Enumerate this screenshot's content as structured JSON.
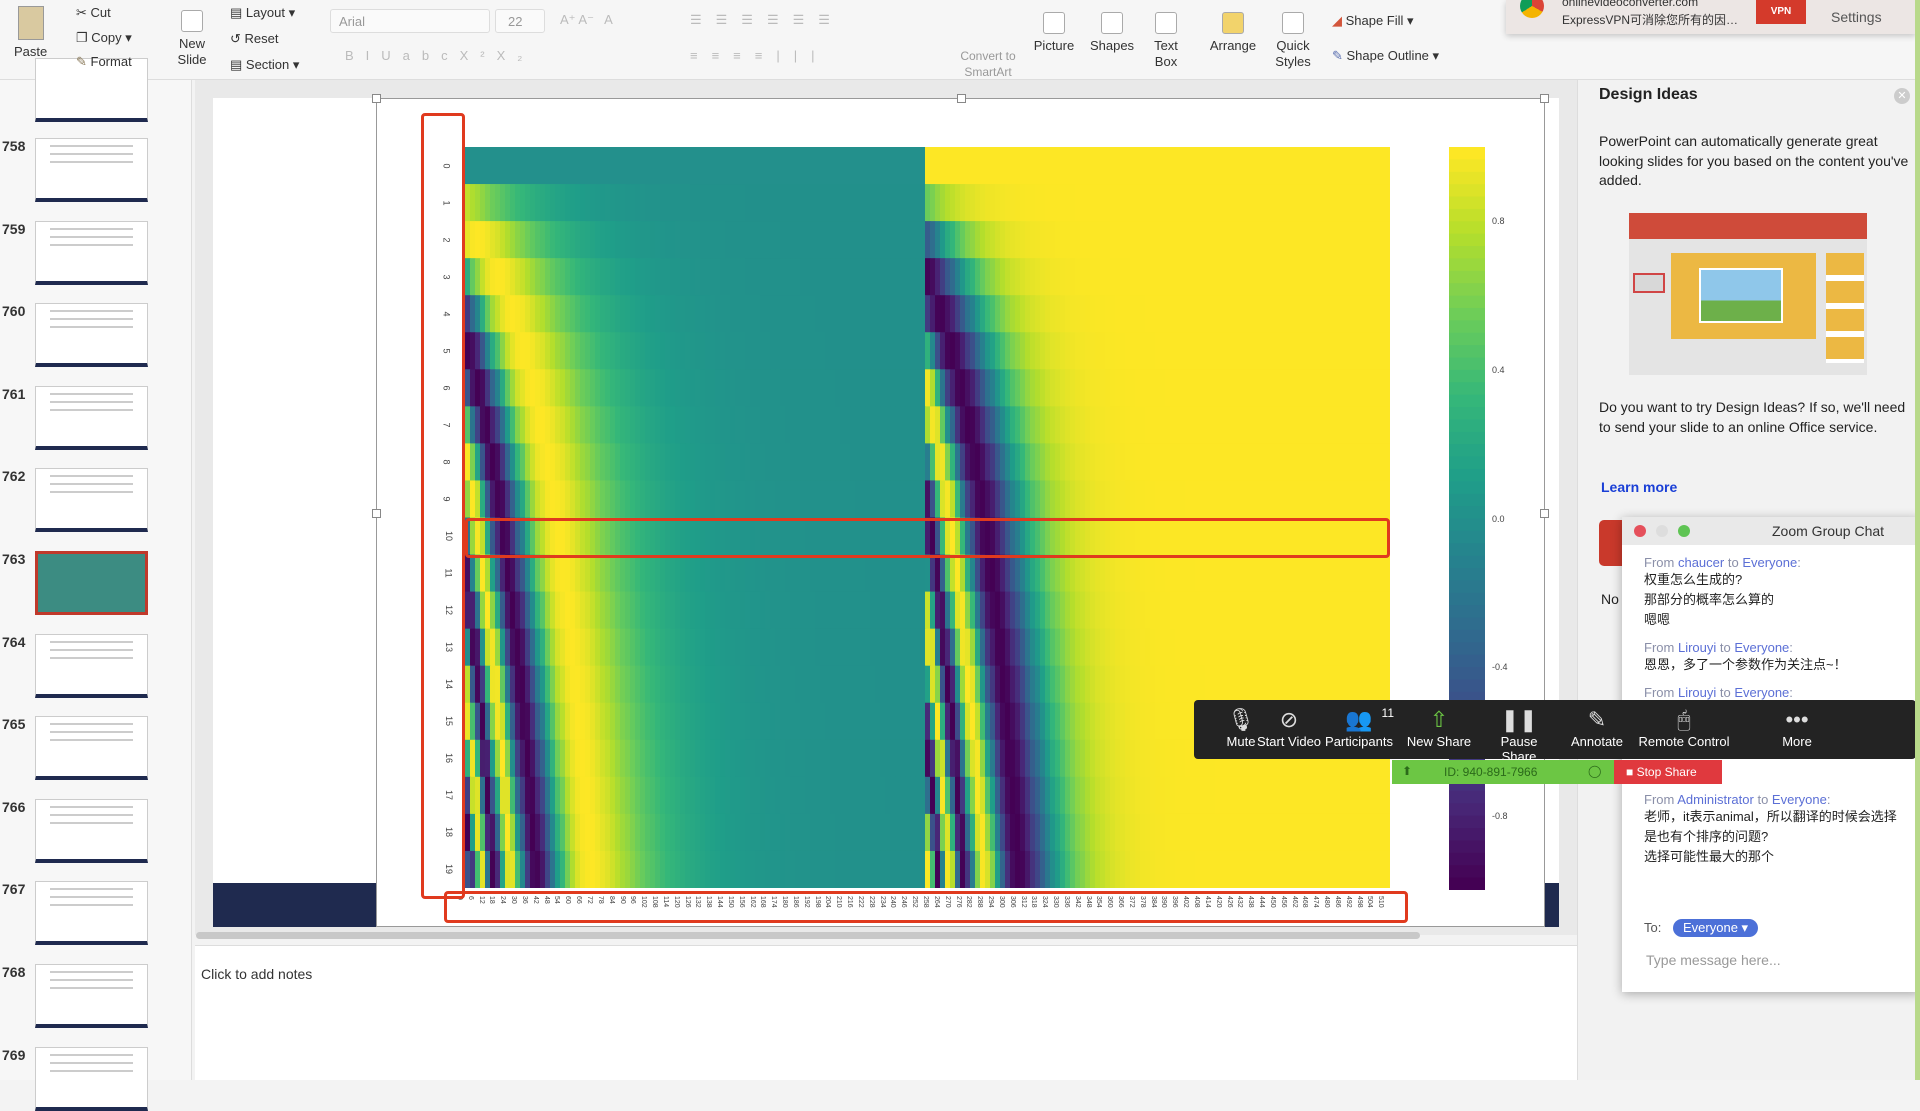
{
  "ribbon": {
    "paste": "Paste",
    "cut": "Cut",
    "copy": "Copy",
    "format": "Format",
    "new_slide": "New Slide",
    "layout": "Layout",
    "reset": "Reset",
    "section": "Section",
    "font_name": "Arial",
    "font_size": "22",
    "convert_smartart": "Convert to SmartArt",
    "picture": "Picture",
    "shapes": "Shapes",
    "text_box": "Text Box",
    "arrange": "Arrange",
    "quick_styles": "Quick Styles",
    "shape_fill": "Shape Fill",
    "shape_outline": "Shape Outline"
  },
  "notification": {
    "title": "onlinevideoconverter.com",
    "body": "ExpressVPN可消除您所有的因…",
    "settings": "Settings",
    "badge": "VPN"
  },
  "thumbnails": [
    {
      "n": "758"
    },
    {
      "n": "759"
    },
    {
      "n": "760"
    },
    {
      "n": "761"
    },
    {
      "n": "762"
    },
    {
      "n": "763",
      "selected": true
    },
    {
      "n": "764"
    },
    {
      "n": "765"
    },
    {
      "n": "766"
    },
    {
      "n": "767"
    },
    {
      "n": "768"
    },
    {
      "n": "769"
    }
  ],
  "notes": {
    "placeholder": "Click to add notes"
  },
  "design_ideas": {
    "title": "Design Ideas",
    "intro": "PowerPoint can automatically generate great looking slides for you based on the content you've added.",
    "question": "Do you want to try Design Ideas? If so, we'll need to send your slide to an online Office service.",
    "learn_more": "Learn more",
    "partial": "No"
  },
  "chat": {
    "title": "Zoom Group Chat",
    "messages": [
      {
        "from": "chaucer",
        "to": "Everyone",
        "lines": [
          "权重怎么生成的?",
          "那部分的概率怎么算的",
          "嗯嗯"
        ]
      },
      {
        "from": "Lirouyi",
        "to": "Everyone",
        "lines": [
          "恩恩，多了一个参数作为关注点~！"
        ]
      },
      {
        "from": "Lirouyi",
        "to": "Everyone",
        "lines": []
      },
      {
        "from": "Administrator",
        "to": "Everyone",
        "lines": [
          "老师，it表示animal，所以翻译的时候会选择",
          "是也有个排序的问题?",
          "选择可能性最大的那个"
        ]
      }
    ],
    "from_label": "From",
    "to_word": "to",
    "to_label": "To:",
    "recipient": "Everyone",
    "input_placeholder": "Type message here..."
  },
  "zoom_toolbar": {
    "buttons": [
      {
        "label": "Mute",
        "icon": "microphone-icon"
      },
      {
        "label": "Start Video",
        "icon": "video-off-icon"
      },
      {
        "label": "Participants",
        "icon": "participants-icon",
        "count": "11"
      },
      {
        "label": "New Share",
        "icon": "share-icon"
      },
      {
        "label": "Pause Share",
        "icon": "pause-icon"
      },
      {
        "label": "Annotate",
        "icon": "pencil-icon"
      },
      {
        "label": "Remote Control",
        "icon": "mouse-icon"
      },
      {
        "label": "More",
        "icon": "more-icon"
      }
    ],
    "meeting_id": "ID: 940-891-7966",
    "stop_share": "Stop Share"
  },
  "colors": {
    "accent_red": "#e03a1e",
    "zoom_green": "#6cc644",
    "stop_red": "#e0393e",
    "link": "#1a3fd6"
  },
  "chart_data": {
    "type": "heatmap",
    "colormap": "viridis",
    "rows": 20,
    "columns": 512,
    "encoding": "columns 0-255: sin(row / 10000^(2i/512)); columns 256-511: cos(row / 10000^(2i/512))",
    "y_tick_labels": [
      "0",
      "1",
      "2",
      "3",
      "4",
      "5",
      "6",
      "7",
      "8",
      "9",
      "10",
      "11",
      "12",
      "13",
      "14",
      "15",
      "16",
      "17",
      "18",
      "19"
    ],
    "x_tick_step": 6,
    "colorbar": {
      "range": [
        -1,
        1
      ],
      "ticks": [
        "0.8",
        "0.4",
        "0.0",
        "-0.4",
        "-0.8"
      ]
    },
    "highlighted_row": 10
  }
}
